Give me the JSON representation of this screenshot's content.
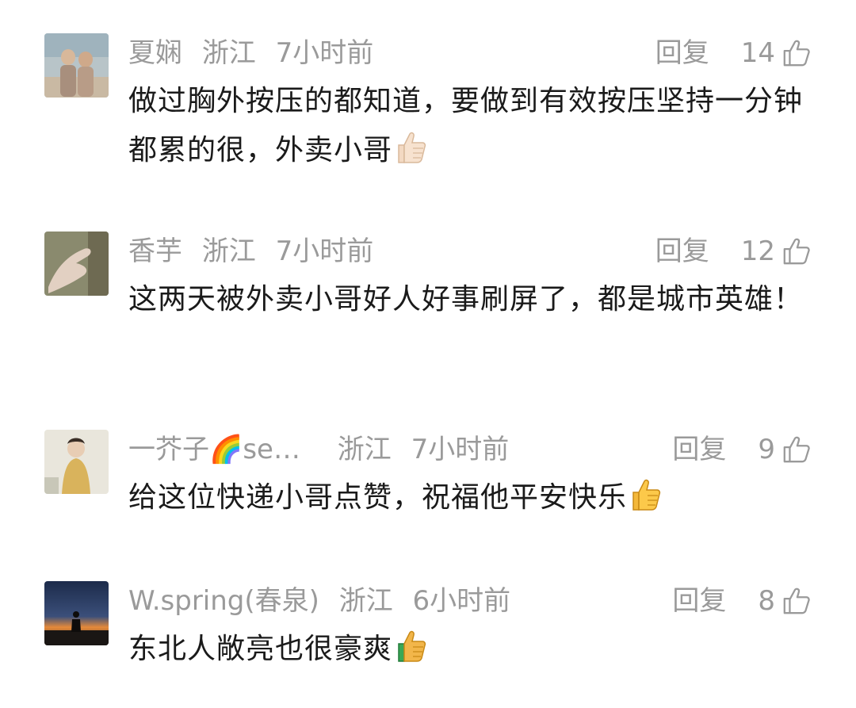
{
  "comments": [
    {
      "username": "夏娴",
      "location": "浙江",
      "time": "7小时前",
      "reply_label": "回复",
      "likes": "14",
      "text": "做过胸外按压的都知道，要做到有效按压坚持一分钟都累的很，外卖小哥",
      "emoji": "thumbs-up-light",
      "avatar_icon": "elderly-couple-photo"
    },
    {
      "username": "香芋",
      "location": "浙江",
      "time": "7小时前",
      "reply_label": "回复",
      "likes": "12",
      "text": "这两天被外卖小哥好人好事刷屏了，都是城市英雄！",
      "avatar_icon": "hand-photo"
    },
    {
      "username": "一芥子🌈se…",
      "location": "浙江",
      "time": "7小时前",
      "reply_label": "回复",
      "likes": "9",
      "text": "给这位快递小哥点赞，祝福他平安快乐",
      "emoji": "thumbs-up-yellow",
      "avatar_icon": "woman-portrait-photo"
    },
    {
      "username": "W.spring(春泉)",
      "location": "浙江",
      "time": "6小时前",
      "reply_label": "回复",
      "likes": "8",
      "text": "东北人敞亮也很豪爽",
      "emoji": "thumbs-up-medium",
      "avatar_icon": "sunset-silhouette-photo"
    }
  ],
  "colors": {
    "meta_text": "#9a9a9a",
    "body_text": "#1a1a1a",
    "background": "#ffffff"
  }
}
